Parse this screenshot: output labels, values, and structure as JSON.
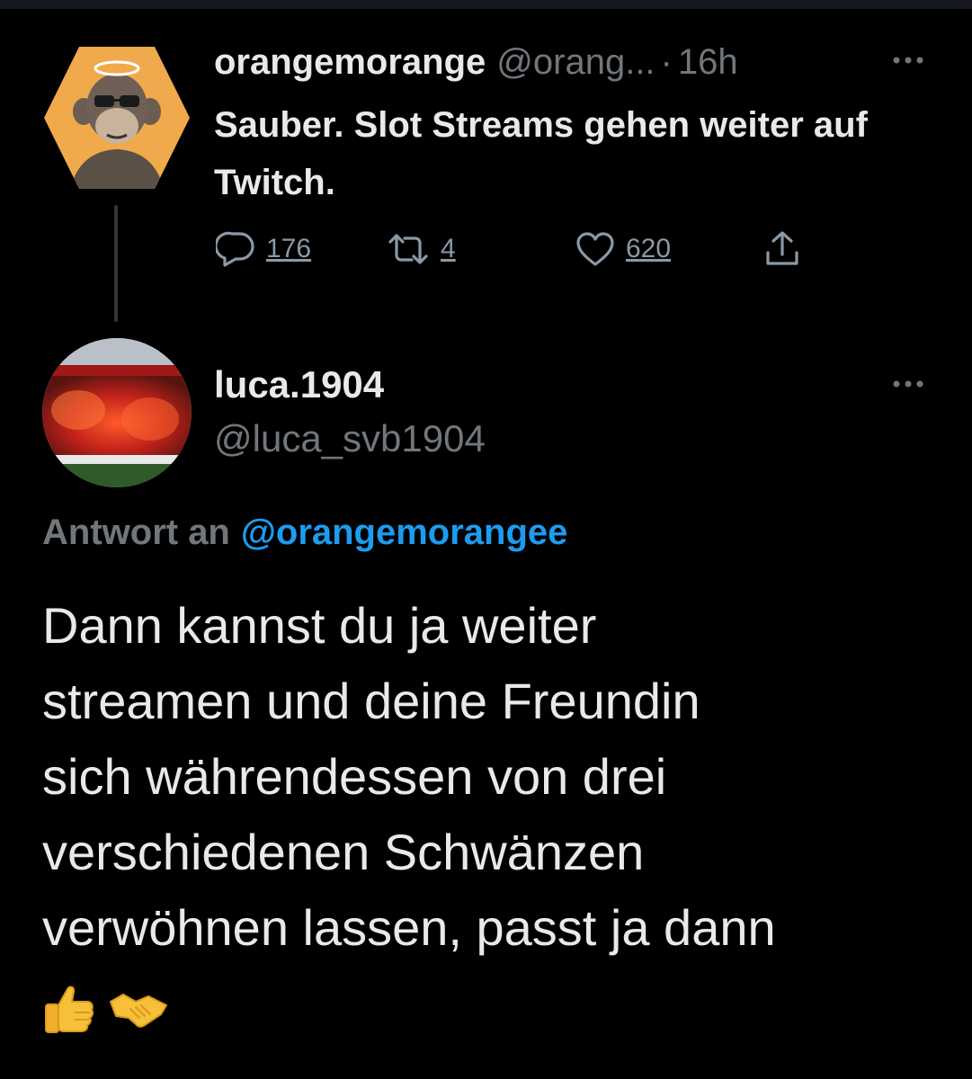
{
  "parent_tweet": {
    "display_name": "orangemorange",
    "handle": "@orang...",
    "separator": "·",
    "time": "16h",
    "text": "Sauber. Slot Streams gehen weiter auf Twitch.",
    "reply_count": "176",
    "retweet_count": "4",
    "like_count": "620",
    "avatar_bg": "#f0a94b"
  },
  "reply_tweet": {
    "display_name": "luca.1904",
    "handle": "@luca_svb1904",
    "replying_label": "Antwort an",
    "replying_to": "@orangemorangee",
    "text_lines": [
      "Dann kannst du ja weiter",
      "streamen und deine Freundin",
      "sich währendessen von drei",
      "verschiedenen Schwänzen",
      "verwöhnen lassen, passt ja dann"
    ],
    "emojis": [
      "thumbs-up",
      "handshake"
    ]
  },
  "colors": {
    "background": "#000000",
    "text": "#e7e9ea",
    "secondary": "#71767b",
    "link": "#1d9bf0"
  }
}
